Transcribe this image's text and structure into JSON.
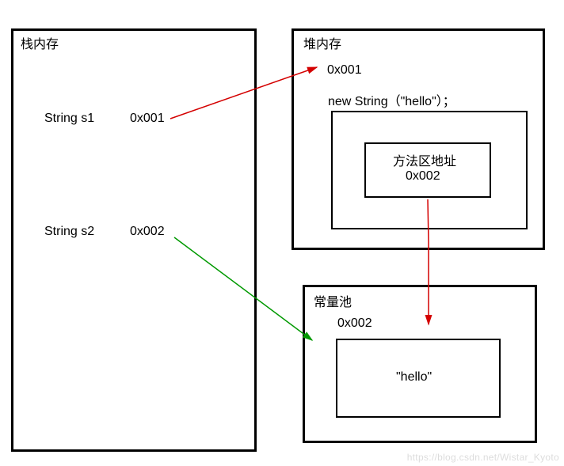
{
  "stack": {
    "title": "栈内存",
    "s1_label": "String s1",
    "s1_addr": "0x001",
    "s2_label": "String s2",
    "s2_addr": "0x002"
  },
  "heap": {
    "title": "堆内存",
    "addr": "0x001",
    "new_expr": "new String（\"hello\"）；",
    "inner_label": "方法区地址",
    "inner_addr": "0x002"
  },
  "pool": {
    "title": "常量池",
    "addr": "0x002",
    "value": "\"hello\""
  },
  "arrows": {
    "s1_to_heap_color": "#d40000",
    "heap_to_pool_color": "#d40000",
    "s2_to_pool_color": "#009900"
  },
  "watermark": "https://blog.csdn.net/Wistar_Kyoto"
}
